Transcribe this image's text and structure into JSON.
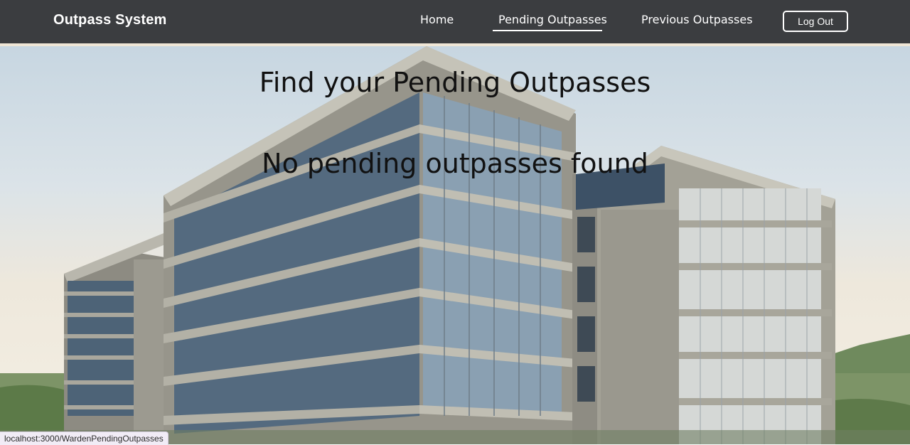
{
  "navbar": {
    "brand": "Outpass System",
    "links": [
      {
        "label": "Home",
        "active": false
      },
      {
        "label": "Pending Outpasses",
        "active": true
      },
      {
        "label": "Previous Outpasses",
        "active": false
      }
    ],
    "logout_label": "Log Out"
  },
  "main": {
    "title": "Find your Pending Outpasses",
    "empty_message": "No pending outpasses found"
  },
  "status_bar": {
    "url": "localhost:3000/WardenPendingOutpasses"
  },
  "colors": {
    "navbar_bg": "#3b3d40",
    "navbar_text": "#ffffff",
    "heading_text": "#111111"
  }
}
